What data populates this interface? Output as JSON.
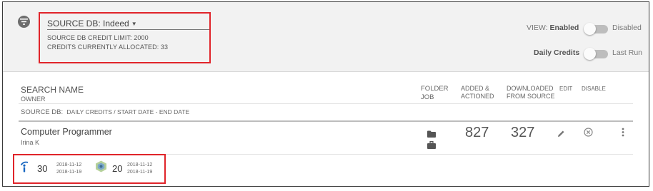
{
  "source": {
    "label": "SOURCE DB:",
    "value": "Indeed",
    "credit_limit": "SOURCE DB CREDIT LIMIT: 2000",
    "credits_allocated": "CREDITS CURRENTLY ALLOCATED: 33"
  },
  "view_toggle": {
    "label": "VIEW:",
    "on_label": "Enabled",
    "off_label": "Disabled"
  },
  "credits_toggle": {
    "on_label": "Daily Credits",
    "off_label": "Last Run"
  },
  "table_header": {
    "search_name": "SEARCH NAME",
    "owner": "OWNER",
    "folder": "FOLDER",
    "job": "JOB",
    "added_line1": "ADDED &",
    "added_line2": "ACTIONED",
    "downloaded_line1": "DOWNLOADED",
    "downloaded_line2": "FROM SOURCE",
    "edit": "EDIT",
    "disable": "DISABLE",
    "source_db": "SOURCE DB:",
    "source_db_detail": "DAILY CREDITS / START DATE - END DATE"
  },
  "row": {
    "title": "Computer Programmer",
    "owner": "Irina K",
    "added": "827",
    "downloaded": "327",
    "stats": [
      {
        "icon": "indeed-icon",
        "value": "30",
        "start": "2018-11-12",
        "end": "2018-11-19"
      },
      {
        "icon": "hexagon-source-icon",
        "value": "20",
        "start": "2018-11-12",
        "end": "2018-11-19"
      }
    ]
  },
  "colors": {
    "highlight": "#e0242a",
    "indeed_blue": "#1565c0",
    "panel_bg": "#f2f2f2"
  }
}
